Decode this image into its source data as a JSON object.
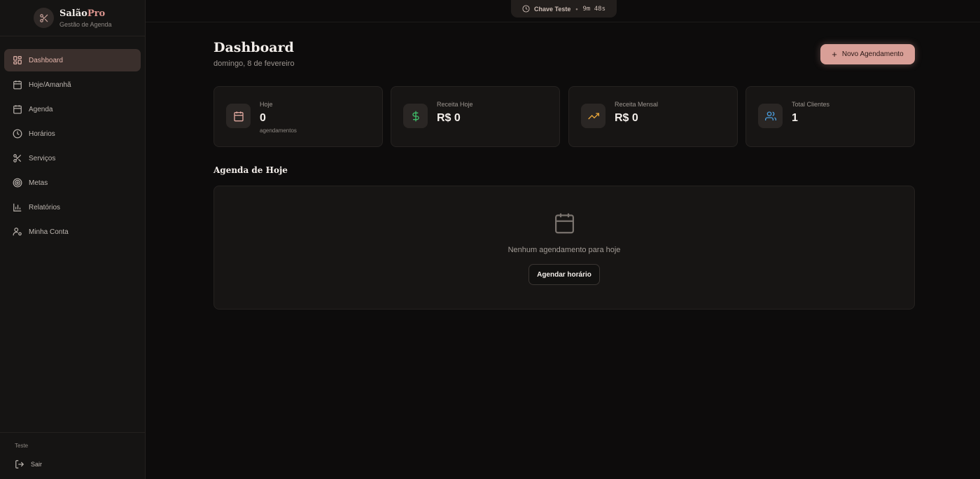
{
  "brand": {
    "name_main": "Salão",
    "name_accent": "Pro",
    "subtitle": "Gestão de Agenda"
  },
  "sidebar": {
    "items": [
      {
        "label": "Dashboard",
        "icon": "dashboard-icon",
        "active": true
      },
      {
        "label": "Hoje/Amanhã",
        "icon": "calendar-days-icon"
      },
      {
        "label": "Agenda",
        "icon": "calendar-icon"
      },
      {
        "label": "Horários",
        "icon": "clock-icon"
      },
      {
        "label": "Serviços",
        "icon": "scissors-icon"
      },
      {
        "label": "Metas",
        "icon": "target-icon"
      },
      {
        "label": "Relatórios",
        "icon": "bar-chart-icon"
      },
      {
        "label": "Minha Conta",
        "icon": "user-settings-icon"
      }
    ],
    "footer": {
      "user": "Teste",
      "logout_label": "Sair"
    }
  },
  "topbar": {
    "key_label": "Chave Teste",
    "separator": "•",
    "countdown": "9m 48s"
  },
  "header": {
    "title": "Dashboard",
    "date": "domingo, 8 de fevereiro",
    "new_button_label": "Novo Agendamento"
  },
  "stats": [
    {
      "label": "Hoje",
      "value": "0",
      "sub": "agendamentos",
      "icon": "calendar-icon",
      "icon_color": "#e0a89f"
    },
    {
      "label": "Receita Hoje",
      "value": "R$ 0",
      "sub": "",
      "icon": "dollar-icon",
      "icon_color": "#3fbf6a"
    },
    {
      "label": "Receita Mensal",
      "value": "R$ 0",
      "sub": "",
      "icon": "trending-up-icon",
      "icon_color": "#e8a53a"
    },
    {
      "label": "Total Clientes",
      "value": "1",
      "sub": "",
      "icon": "users-icon",
      "icon_color": "#4a9fe0"
    }
  ],
  "agenda": {
    "title": "Agenda de Hoje",
    "empty_text": "Nenhum agendamento para hoje",
    "button_label": "Agendar horário"
  }
}
